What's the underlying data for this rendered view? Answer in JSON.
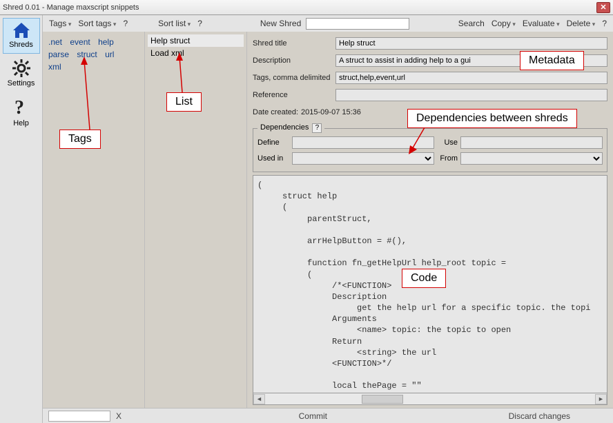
{
  "window": {
    "title": "Shred 0.01 - Manage maxscript snippets"
  },
  "sidebar": {
    "items": [
      {
        "label": "Shreds",
        "selected": true
      },
      {
        "label": "Settings",
        "selected": false
      },
      {
        "label": "Help",
        "selected": false
      }
    ]
  },
  "menubar": {
    "left": [
      {
        "label": "Tags",
        "dropdown": true
      },
      {
        "label": "Sort tags",
        "dropdown": true
      },
      {
        "label": "?",
        "dropdown": false
      }
    ],
    "mid": [
      {
        "label": "Sort list",
        "dropdown": true
      },
      {
        "label": "?",
        "dropdown": false
      }
    ],
    "newshred_label": "New Shred",
    "newshred_value": "",
    "right": [
      {
        "label": "Search",
        "dropdown": false
      },
      {
        "label": "Copy",
        "dropdown": true
      },
      {
        "label": "Evaluate",
        "dropdown": true
      },
      {
        "label": "Delete",
        "dropdown": true
      },
      {
        "label": "?",
        "dropdown": false
      }
    ]
  },
  "tags": [
    ".net",
    "event",
    "help",
    "parse",
    "struct",
    "url",
    "xml"
  ],
  "list": [
    {
      "label": "Help struct",
      "selected": true
    },
    {
      "label": "Load xml",
      "selected": false
    }
  ],
  "detail": {
    "shred_title_label": "Shred title",
    "shred_title": "Help struct",
    "description_label": "Description",
    "description": "A struct to assist in adding help to a gui",
    "tags_label": "Tags, comma delimited",
    "tags": "struct,help,event,url",
    "reference_label": "Reference",
    "reference": "",
    "date_created_label": "Date created:",
    "date_created": "2015-09-07 15:36",
    "deps_legend": "Dependencies",
    "define_label": "Define",
    "define": "",
    "use_label": "Use",
    "use": "",
    "usedin_label": "Used in",
    "usedin": "",
    "from_label": "From",
    "from": ""
  },
  "code": "(\n     struct help\n     (\n          parentStruct,\n\n          arrHelpButton = #(),\n\n          function fn_getHelpUrl help_root topic =\n          (\n               /*<FUNCTION>\n               Description\n                    get the help url for a specific topic. the topi\n               Arguments\n                    <name> topic: the topic to open\n               Return\n                    <string> the url\n               <FUNCTION>*/\n\n               local thePage = \"\"\n               thePage = case topic of\n               (\n                    #help_generic: \"index.html\"\n                    #help_list: \"List.html\"",
  "status": {
    "x": "X",
    "commit": "Commit",
    "discard": "Discard changes"
  },
  "callouts": {
    "tags": "Tags",
    "list": "List",
    "metadata": "Metadata",
    "deps": "Dependencies between shreds",
    "code": "Code"
  }
}
